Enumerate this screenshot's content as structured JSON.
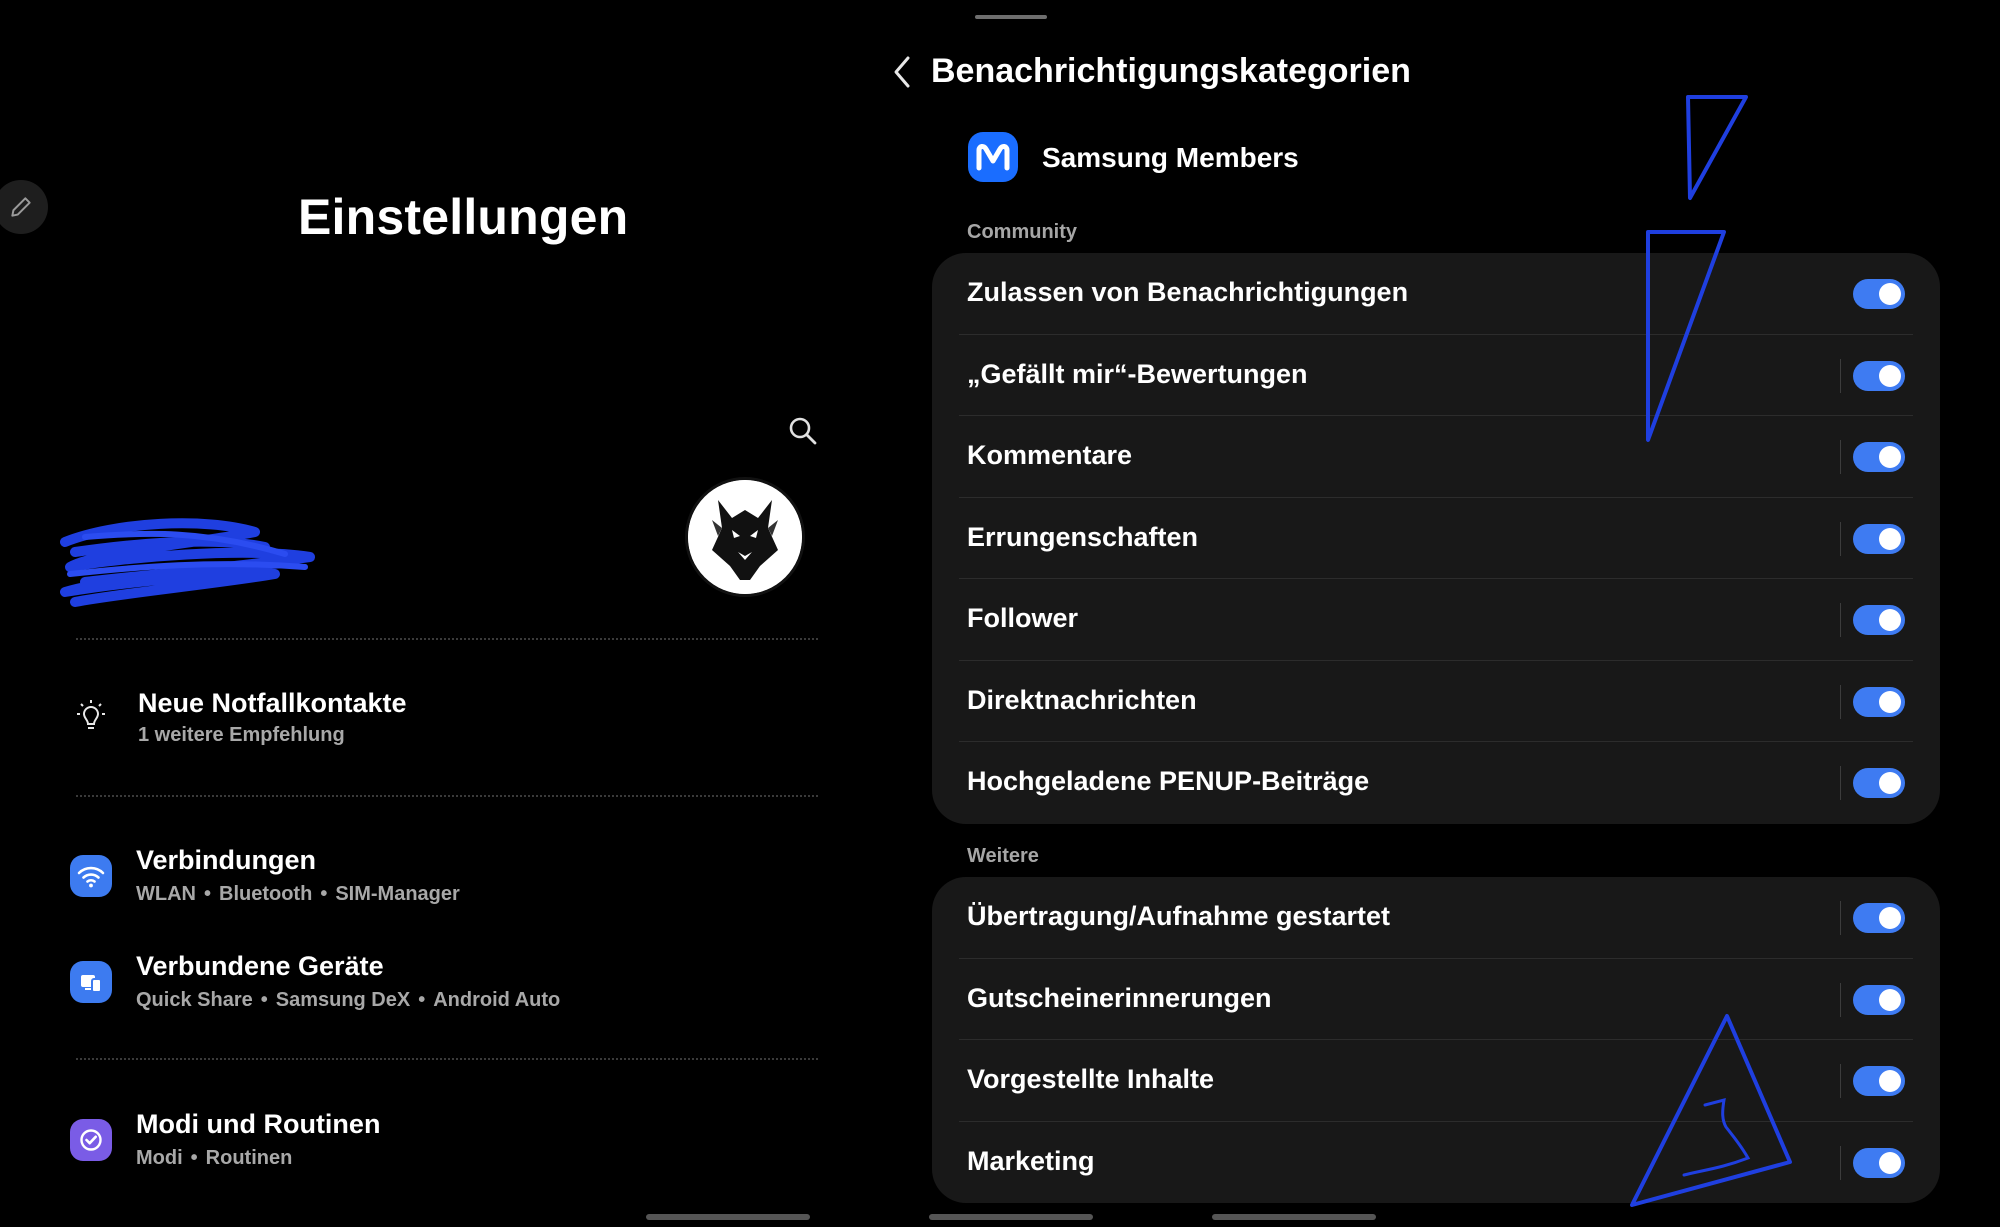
{
  "left": {
    "title": "Einstellungen",
    "suggestion": {
      "title": "Neue Notfallkontakte",
      "subtitle": "1 weitere Empfehlung",
      "icon": "lightbulb-icon"
    },
    "menu": [
      {
        "title": "Verbindungen",
        "subs": [
          "WLAN",
          "Bluetooth",
          "SIM-Manager"
        ],
        "icon": "wifi-icon",
        "color": "#3d7bf0"
      },
      {
        "title": "Verbundene Geräte",
        "subs": [
          "Quick Share",
          "Samsung DeX",
          "Android Auto"
        ],
        "icon": "devices-icon",
        "color": "#3d7bf0"
      },
      {
        "title": "Modi und Routinen",
        "subs": [
          "Modi",
          "Routinen"
        ],
        "icon": "check-circle-icon",
        "color": "#7a5ce6"
      }
    ]
  },
  "right": {
    "title": "Benachrichtigungskategorien",
    "app_name": "Samsung Members",
    "sections": [
      {
        "label": "Community",
        "items": [
          {
            "label": "Zulassen von Benachrichtigungen",
            "on": true
          },
          {
            "label": "„Gefällt mir“-Bewertungen",
            "on": true
          },
          {
            "label": "Kommentare",
            "on": true
          },
          {
            "label": "Errungenschaften",
            "on": true
          },
          {
            "label": "Follower",
            "on": true
          },
          {
            "label": "Direktnachrichten",
            "on": true
          },
          {
            "label": "Hochgeladene PENUP-Beiträge",
            "on": true
          }
        ]
      },
      {
        "label": "Weitere",
        "items": [
          {
            "label": "Übertragung/Aufnahme gestartet",
            "on": true
          },
          {
            "label": "Gutscheinerinnerungen",
            "on": true
          },
          {
            "label": "Vorgestellte Inhalte",
            "on": true
          },
          {
            "label": "Marketing",
            "on": true
          }
        ]
      }
    ]
  },
  "colors": {
    "accent": "#3e7bf2",
    "annotation": "#1f3fe0",
    "background": "#000000",
    "card": "#181818"
  }
}
